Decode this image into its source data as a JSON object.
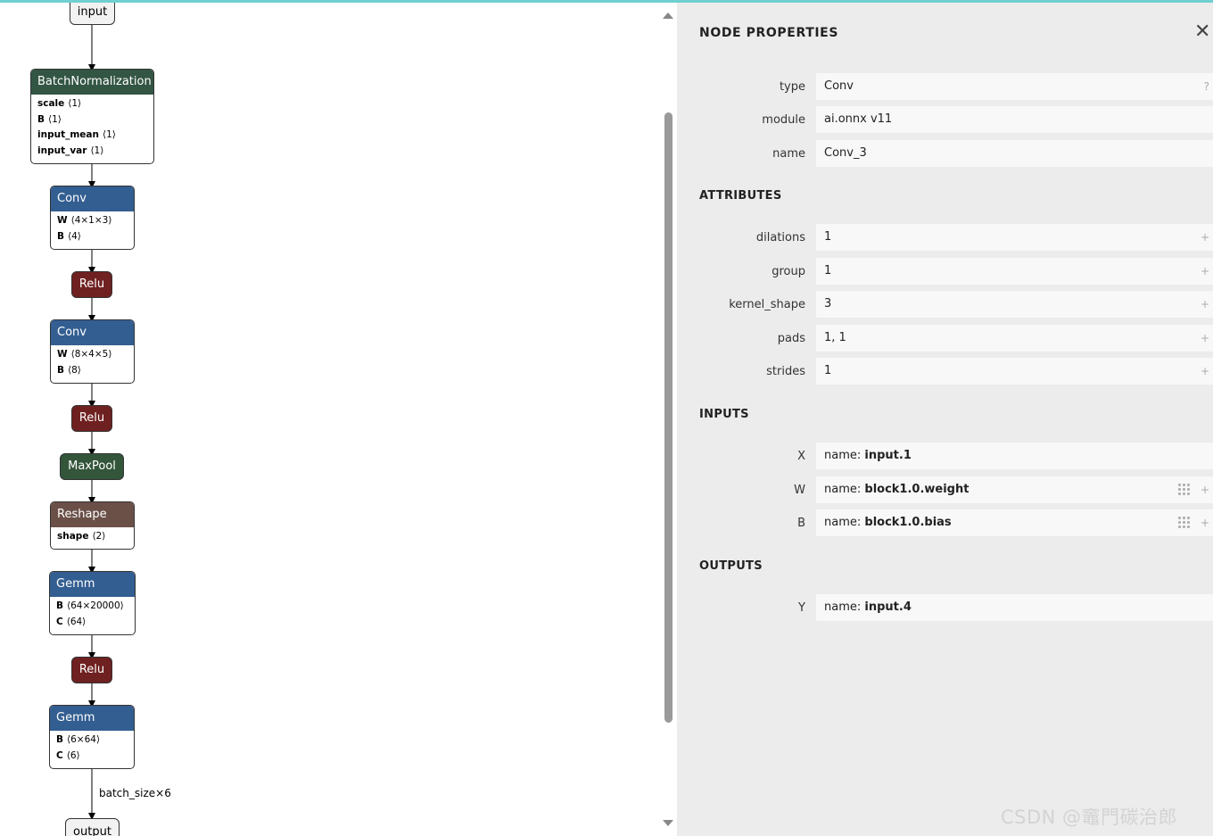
{
  "graph": {
    "input_label": "input",
    "output_label": "output",
    "edge_label": "batch_size×6",
    "nodes": [
      {
        "type": "BatchNormalization",
        "attrs": [
          {
            "name": "scale",
            "shape": "⟨1⟩"
          },
          {
            "name": "B",
            "shape": "⟨1⟩"
          },
          {
            "name": "input_mean",
            "shape": "⟨1⟩"
          },
          {
            "name": "input_var",
            "shape": "⟨1⟩"
          }
        ]
      },
      {
        "type": "Conv",
        "attrs": [
          {
            "name": "W",
            "shape": "⟨4×1×3⟩"
          },
          {
            "name": "B",
            "shape": "⟨4⟩"
          }
        ]
      },
      {
        "type": "Relu"
      },
      {
        "type": "Conv",
        "attrs": [
          {
            "name": "W",
            "shape": "⟨8×4×5⟩"
          },
          {
            "name": "B",
            "shape": "⟨8⟩"
          }
        ]
      },
      {
        "type": "Relu"
      },
      {
        "type": "MaxPool"
      },
      {
        "type": "Reshape",
        "attrs": [
          {
            "name": "shape",
            "shape": "⟨2⟩"
          }
        ]
      },
      {
        "type": "Gemm",
        "attrs": [
          {
            "name": "B",
            "shape": "⟨64×20000⟩"
          },
          {
            "name": "C",
            "shape": "⟨64⟩"
          }
        ]
      },
      {
        "type": "Relu"
      },
      {
        "type": "Gemm",
        "attrs": [
          {
            "name": "B",
            "shape": "⟨6×64⟩"
          },
          {
            "name": "C",
            "shape": "⟨6⟩"
          }
        ]
      }
    ]
  },
  "panel": {
    "title": "NODE PROPERTIES",
    "close_glyph": "✕",
    "props": [
      {
        "label": "type",
        "value": "Conv",
        "icon": "?"
      },
      {
        "label": "module",
        "value": "ai.onnx v11"
      },
      {
        "label": "name",
        "value": "Conv_3"
      }
    ],
    "attributes_title": "ATTRIBUTES",
    "attributes": [
      {
        "label": "dilations",
        "value": "1",
        "icon": "+"
      },
      {
        "label": "group",
        "value": "1",
        "icon": "+"
      },
      {
        "label": "kernel_shape",
        "value": "3",
        "icon": "+"
      },
      {
        "label": "pads",
        "value": "1, 1",
        "icon": "+"
      },
      {
        "label": "strides",
        "value": "1",
        "icon": "+"
      }
    ],
    "inputs_title": "INPUTS",
    "inputs": [
      {
        "label": "X",
        "prefix": "name: ",
        "value": "input.1"
      },
      {
        "label": "W",
        "prefix": "name: ",
        "value": "block1.0.weight",
        "icon": "+"
      },
      {
        "label": "B",
        "prefix": "name: ",
        "value": "block1.0.bias",
        "icon": "+"
      }
    ],
    "outputs_title": "OUTPUTS",
    "outputs": [
      {
        "label": "Y",
        "prefix": "name: ",
        "value": "input.4"
      }
    ]
  },
  "watermark": "CSDN @竈門碳治郎"
}
